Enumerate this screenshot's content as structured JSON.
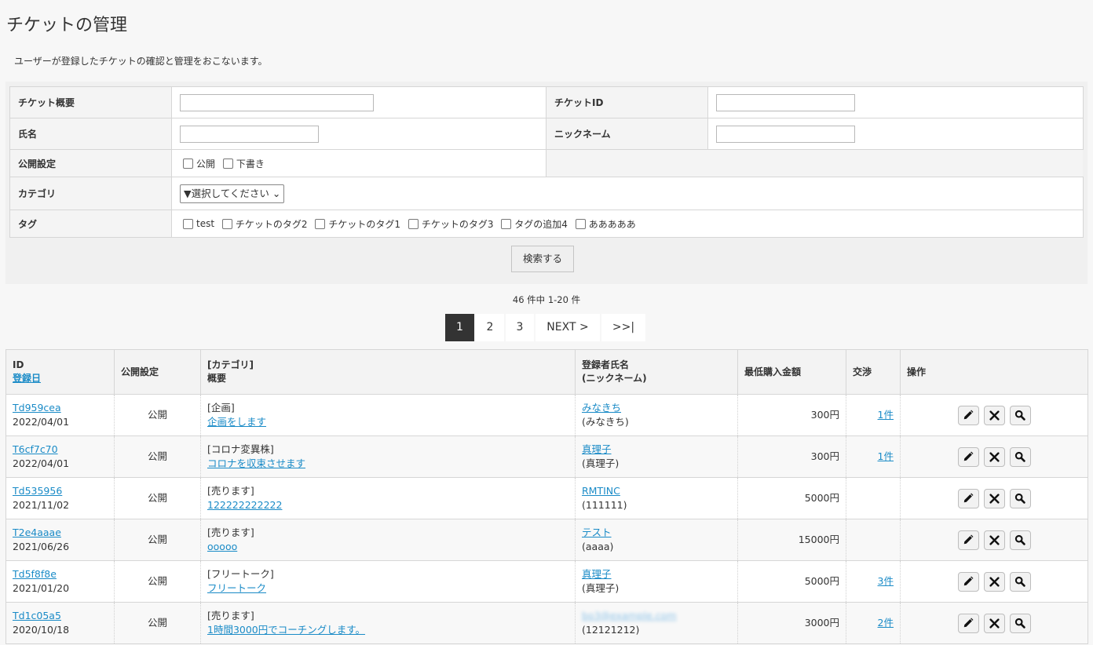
{
  "page": {
    "title": "チケットの管理",
    "description": "ユーザーが登録したチケットの確認と管理をおこないます。"
  },
  "search": {
    "summary_label": "チケット概要",
    "ticket_id_label": "チケットID",
    "name_label": "氏名",
    "nickname_label": "ニックネーム",
    "publish_label": "公開設定",
    "publish_options": [
      "公開",
      "下書き"
    ],
    "category_label": "カテゴリ",
    "category_selected": "▼選択してください",
    "tag_label": "タグ",
    "tags": [
      "test",
      "チケットのタグ2",
      "チケットのタグ1",
      "チケットのタグ3",
      "タグの追加4",
      "あああああ"
    ],
    "button": "検索する"
  },
  "result_count": "46 件中 1-20 件",
  "pagination": {
    "pages": [
      "1",
      "2",
      "3"
    ],
    "active": "1",
    "next": "NEXT >",
    "last": ">>|"
  },
  "table": {
    "headers": {
      "id": "ID",
      "date": "登録日",
      "publish": "公開設定",
      "category": "[カテゴリ]",
      "summary": "概要",
      "registrant": "登録者氏名",
      "nickname": "(ニックネーム)",
      "min_price": "最低購入金額",
      "negotiation": "交渉",
      "ops": "操作"
    },
    "rows": [
      {
        "id": "Td959cea",
        "date": "2022/04/01",
        "status": "公開",
        "category": "[企画]",
        "summary": "企画をします",
        "name": "みなきち",
        "nickname": "(みなきち)",
        "price": "300円",
        "nego": "1件"
      },
      {
        "id": "T6cf7c70",
        "date": "2022/04/01",
        "status": "公開",
        "category": "[コロナ変異株]",
        "summary": "コロナを収束させます",
        "name": "真理子",
        "nickname": "(真理子)",
        "price": "300円",
        "nego": "1件"
      },
      {
        "id": "Td535956",
        "date": "2021/11/02",
        "status": "公開",
        "category": "[売ります]",
        "summary": "122222222222",
        "name": "RMTINC",
        "nickname": "(111111)",
        "price": "5000円",
        "nego": ""
      },
      {
        "id": "T2e4aaae",
        "date": "2021/06/26",
        "status": "公開",
        "category": "[売ります]",
        "summary": "ooooo",
        "name": "テスト",
        "nickname": "(aaaa)",
        "price": "15000円",
        "nego": ""
      },
      {
        "id": "Td5f8f8e",
        "date": "2021/01/20",
        "status": "公開",
        "category": "[フリートーク]",
        "summary": "フリートーク",
        "name": "真理子",
        "nickname": "(真理子)",
        "price": "5000円",
        "nego": "3件"
      },
      {
        "id": "Td1c05a5",
        "date": "2020/10/18",
        "status": "公開",
        "category": "[売ります]",
        "summary": "1時間3000円でコーチングします。",
        "name": "bo3@example.com",
        "nickname": "(12121212)",
        "price": "3000円",
        "nego": "2件"
      }
    ]
  }
}
